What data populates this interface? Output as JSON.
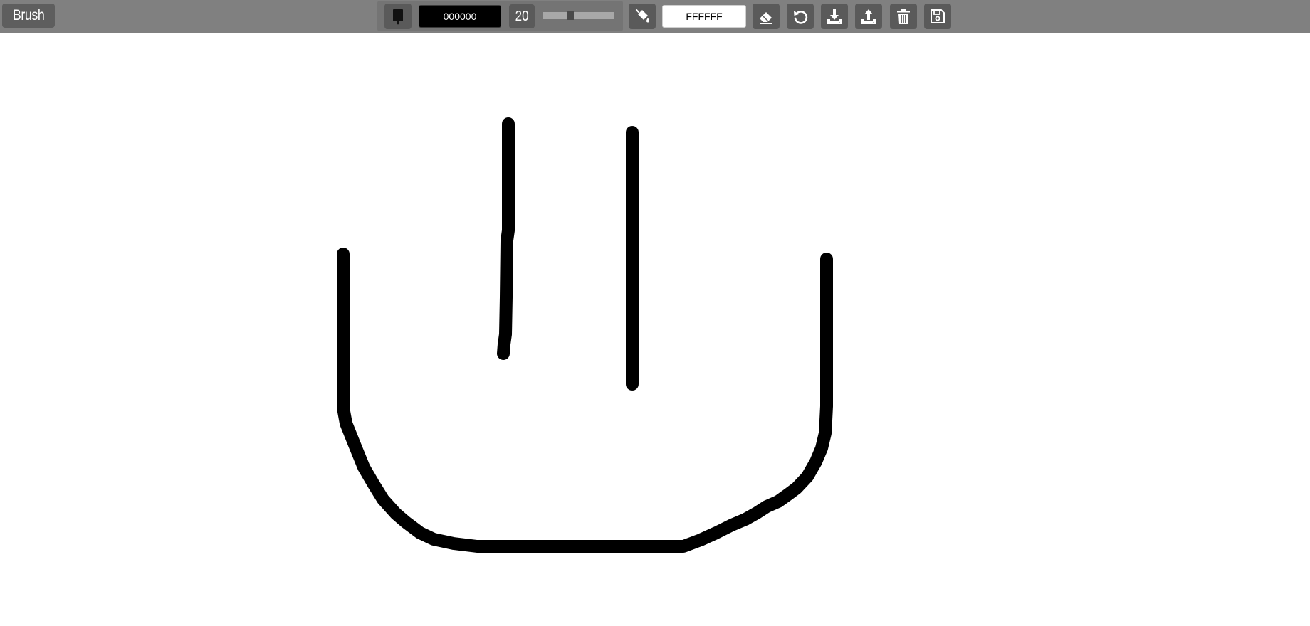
{
  "tool": {
    "title": "Brush"
  },
  "brush": {
    "icon": "brush-icon",
    "color_value": "000000",
    "size_value": "20",
    "size_slider": {
      "value": 20,
      "min": 1,
      "max": 60,
      "fraction": 0.38
    }
  },
  "fill": {
    "icon": "paint-bucket-icon",
    "color_value": "FFFFFF"
  },
  "actions": [
    {
      "name": "eraser",
      "icon": "eraser-icon"
    },
    {
      "name": "undo",
      "icon": "undo-icon"
    },
    {
      "name": "download",
      "icon": "download-icon"
    },
    {
      "name": "upload",
      "icon": "upload-icon"
    },
    {
      "name": "clear",
      "icon": "trash-icon"
    },
    {
      "name": "save",
      "icon": "floppy-disk-icon"
    }
  ],
  "colors": {
    "toolbar": "#808080",
    "button": "#5a5a5a",
    "stroke": "#000000",
    "canvas": "#ffffff"
  }
}
